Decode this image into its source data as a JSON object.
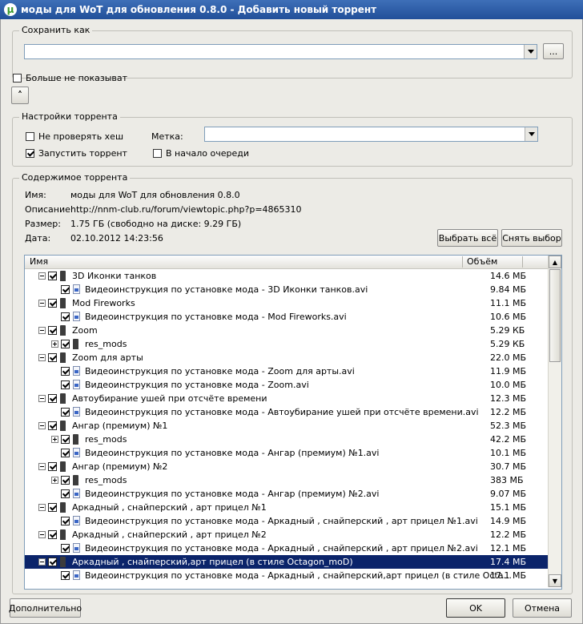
{
  "window": {
    "title": "моды для WoT для обновления 0.8.0 - Добавить новый торрент"
  },
  "save_as": {
    "group_label": "Сохранить как",
    "path_value": "",
    "browse_label": "..."
  },
  "dont_show": {
    "label": "Больше не показыват",
    "checked": false
  },
  "settings": {
    "group_label": "Настройки торрента",
    "skip_hash_label": "Не проверять хеш",
    "start_label": "Запустить торрент",
    "label_label": "Метка:",
    "label_value": "",
    "queue_top_label": "В начало очереди"
  },
  "content": {
    "group_label": "Содержимое торрента",
    "name_key": "Имя:",
    "name_value": "моды для WoT для обновления 0.8.0",
    "desc_key": "Описание",
    "desc_value": "http://nnm-club.ru/forum/viewtopic.php?p=4865310",
    "size_key": "Размер:",
    "size_value": "1.75 ГБ (свободно на диске: 9.29 ГБ)",
    "date_key": "Дата:",
    "date_value": "02.10.2012 14:23:56",
    "select_all_label": "Выбрать всё",
    "deselect_label": "Снять выбор"
  },
  "table": {
    "col_name": "Имя",
    "col_size": "Объём",
    "rows": [
      {
        "level": 0,
        "type": "folder",
        "toggle": "minus",
        "name": "3D Иконки танков",
        "size": "14.6 МБ"
      },
      {
        "level": 1,
        "type": "file",
        "name": "Видеоинструкция по установке мода - 3D Иконки танков.avi",
        "size": "9.84 МБ"
      },
      {
        "level": 0,
        "type": "folder",
        "toggle": "minus",
        "name": "Mod Fireworks",
        "size": "11.1 МБ"
      },
      {
        "level": 1,
        "type": "file",
        "name": "Видеоинструкция по установке мода - Mod Fireworks.avi",
        "size": "10.6 МБ"
      },
      {
        "level": 0,
        "type": "folder",
        "toggle": "minus",
        "name": "Zoom",
        "size": "5.29 КБ"
      },
      {
        "level": 1,
        "type": "folder",
        "toggle": "plus",
        "name": "res_mods",
        "size": "5.29 КБ"
      },
      {
        "level": 0,
        "type": "folder",
        "toggle": "minus",
        "name": "Zoom для арты",
        "size": "22.0 МБ"
      },
      {
        "level": 1,
        "type": "file",
        "name": "Видеоинструкция по установке мода - Zoom для арты.avi",
        "size": "11.9 МБ"
      },
      {
        "level": 1,
        "type": "file",
        "name": "Видеоинструкция по установке мода - Zoom.avi",
        "size": "10.0 МБ"
      },
      {
        "level": 0,
        "type": "folder",
        "toggle": "minus",
        "name": "Автоубирание ушей при отсчёте времени",
        "size": "12.3 МБ"
      },
      {
        "level": 1,
        "type": "file",
        "name": "Видеоинструкция по установке мода - Автоубирание ушей при отсчёте времени.avi",
        "size": "12.2 МБ"
      },
      {
        "level": 0,
        "type": "folder",
        "toggle": "minus",
        "name": "Ангар (премиум) №1",
        "size": "52.3 МБ"
      },
      {
        "level": 1,
        "type": "folder",
        "toggle": "plus",
        "name": "res_mods",
        "size": "42.2 МБ"
      },
      {
        "level": 1,
        "type": "file",
        "name": "Видеоинструкция по установке мода - Ангар (премиум) №1.avi",
        "size": "10.1 МБ"
      },
      {
        "level": 0,
        "type": "folder",
        "toggle": "minus",
        "name": "Ангар (премиум) №2",
        "size": "30.7 МБ"
      },
      {
        "level": 1,
        "type": "folder",
        "toggle": "plus",
        "name": "res_mods",
        "size": "383 МБ"
      },
      {
        "level": 1,
        "type": "file",
        "name": "Видеоинструкция по установке мода - Ангар (премиум) №2.avi",
        "size": "9.07 МБ"
      },
      {
        "level": 0,
        "type": "folder",
        "toggle": "minus",
        "name": "Аркадный , снайперский , арт прицел №1",
        "size": "15.1 МБ"
      },
      {
        "level": 1,
        "type": "file",
        "name": "Видеоинструкция по установке мода - Аркадный , снайперский , арт прицел №1.avi",
        "size": "14.9 МБ"
      },
      {
        "level": 0,
        "type": "folder",
        "toggle": "minus",
        "name": "Аркадный , снайперский , арт прицел №2",
        "size": "12.2 МБ"
      },
      {
        "level": 1,
        "type": "file",
        "name": "Видеоинструкция по установке мода - Аркадный , снайперский , арт прицел №2.avi",
        "size": "12.1 МБ"
      },
      {
        "level": 0,
        "type": "folder",
        "toggle": "minus",
        "name": "Аркадный , снайперский,арт прицел (в стиле Octagon_moD)",
        "size": "17.4 МБ",
        "selected": true
      },
      {
        "level": 1,
        "type": "file",
        "name": "Видеоинструкция по установке мода - Аркадный , снайперский,арт прицел (в стиле Octa...",
        "size": "17.1 МБ"
      }
    ]
  },
  "footer": {
    "advanced_label": "Дополнительно",
    "ok_label": "OK",
    "cancel_label": "Отмена"
  }
}
